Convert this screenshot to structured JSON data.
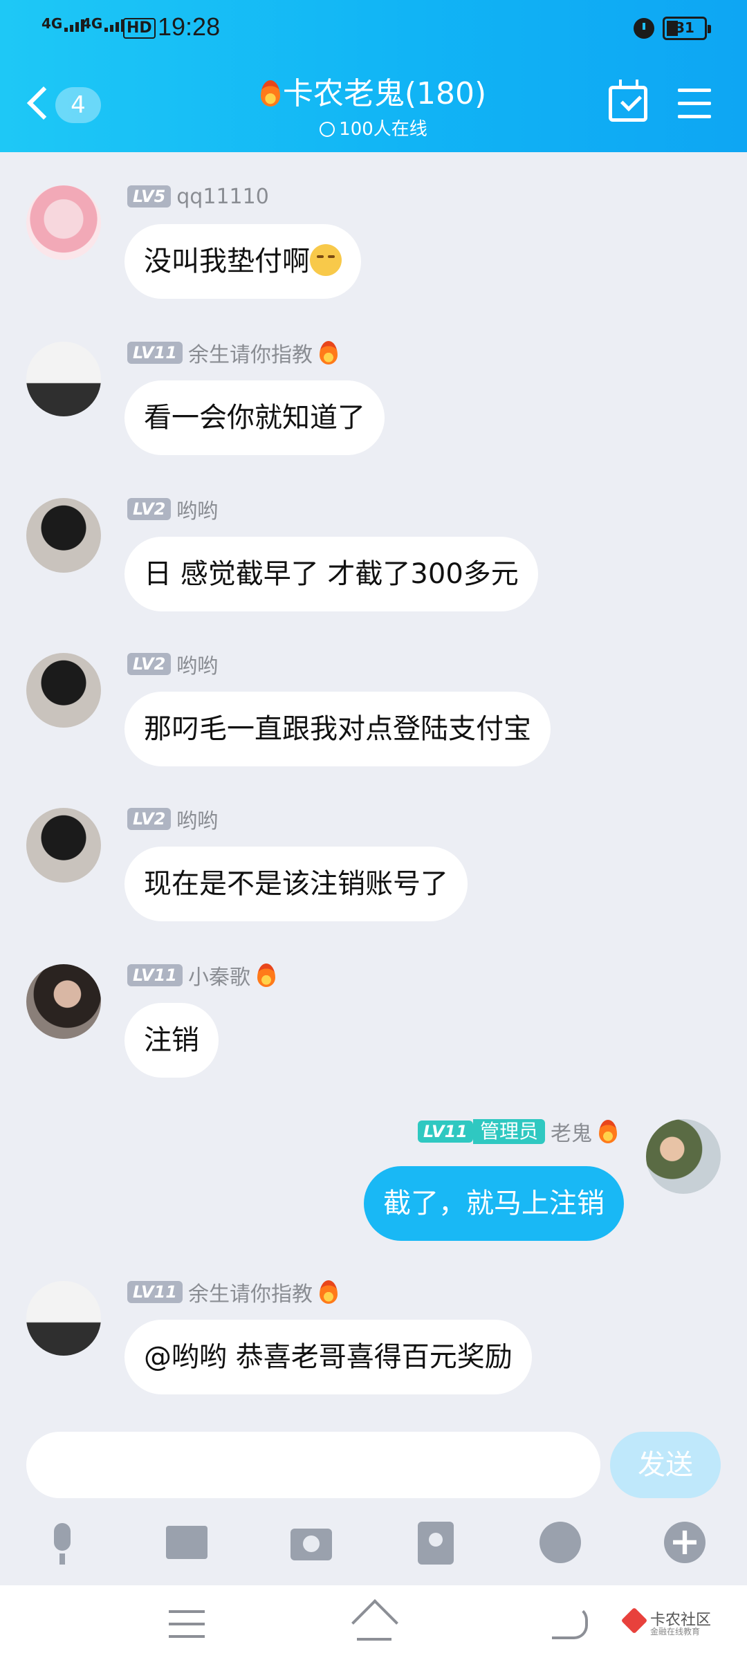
{
  "status_bar": {
    "net1": "4G",
    "net2": "4G",
    "hd": "HD",
    "time": "19:28",
    "battery": "31"
  },
  "header": {
    "unread_count": "4",
    "title": "卡农老鬼(180)",
    "online": "100人在线"
  },
  "messages": [
    {
      "level": "LV5",
      "name": "qq11110",
      "text": "没叫我垫付啊",
      "has_emoji": true
    },
    {
      "level": "LV11",
      "name": "余生请你指教",
      "text": "看一会你就知道了"
    },
    {
      "level": "LV2",
      "name": "哟哟",
      "text": "日  感觉截早了  才截了300多元"
    },
    {
      "level": "LV2",
      "name": "哟哟",
      "text": "那叼毛一直跟我对点登陆支付宝"
    },
    {
      "level": "LV2",
      "name": "哟哟",
      "text": "现在是不是该注销账号了"
    },
    {
      "level": "LV11",
      "name": "小秦歌",
      "text": "注销"
    },
    {
      "level": "LV11",
      "role": "管理员",
      "name": "老鬼",
      "text": "截了，就马上注销",
      "mine": true
    },
    {
      "level": "LV11",
      "name": "余生请你指教",
      "text": "@哟哟  恭喜老哥喜得百元奖励"
    }
  ],
  "composer": {
    "placeholder": "",
    "send_label": "发送"
  },
  "nav": {
    "brand_name": "卡农社区",
    "brand_sub": "金融在线教育"
  },
  "colors": {
    "header": "#11b4f5",
    "my_bubble": "#19b8f5",
    "admin_badge": "#2fc8c1",
    "background": "#eceef4"
  }
}
